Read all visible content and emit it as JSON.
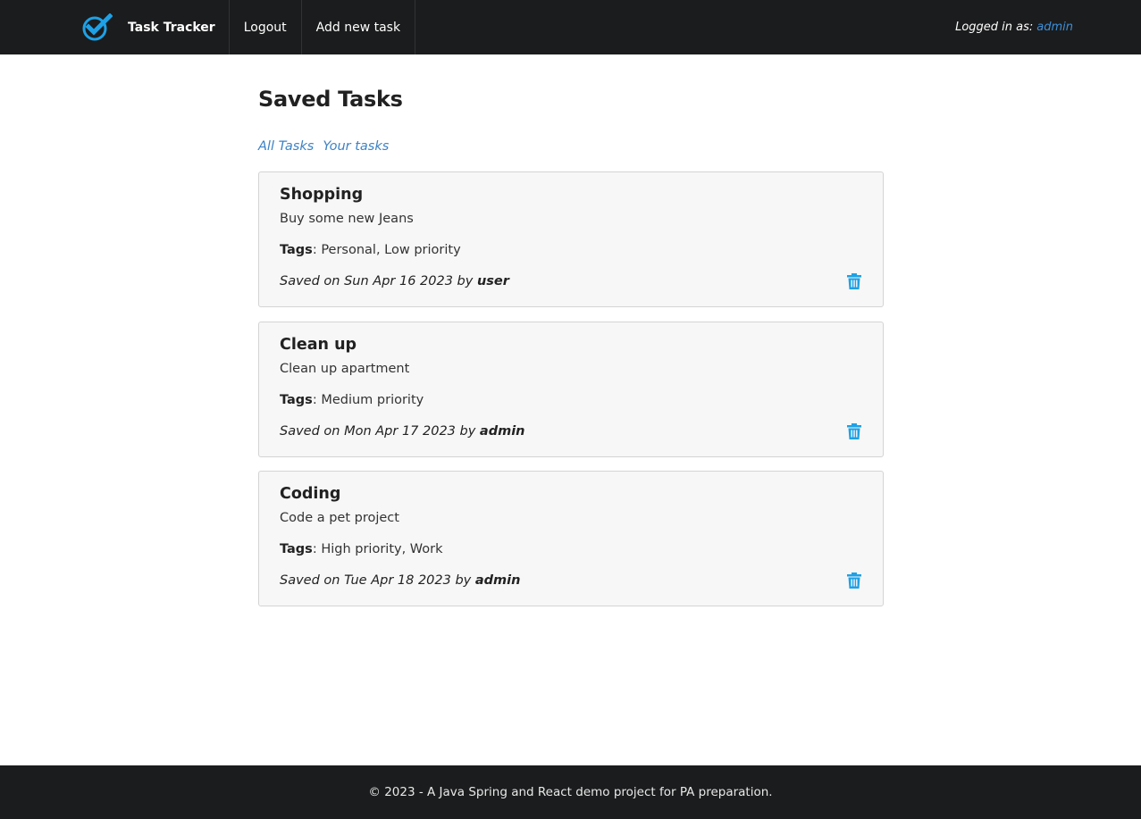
{
  "nav": {
    "brand": "Task Tracker",
    "logout": "Logout",
    "add_task": "Add new task",
    "logged_in_label": "Logged in as:",
    "logged_in_user": "admin"
  },
  "page": {
    "title": "Saved Tasks",
    "filters": {
      "all": "All Tasks",
      "yours": "Your tasks"
    }
  },
  "tasks": [
    {
      "title": "Shopping",
      "description": "Buy some new Jeans",
      "tags_label": "Tags",
      "tags": ": Personal, Low priority",
      "saved_prefix": "Saved on Sun Apr 16 2023 by",
      "author": "user"
    },
    {
      "title": "Clean up",
      "description": "Clean up apartment",
      "tags_label": "Tags",
      "tags": ": Medium priority",
      "saved_prefix": "Saved on Mon Apr 17 2023 by",
      "author": "admin"
    },
    {
      "title": "Coding",
      "description": "Code a pet project",
      "tags_label": "Tags",
      "tags": ": High priority, Work",
      "saved_prefix": "Saved on Tue Apr 18 2023 by",
      "author": "admin"
    }
  ],
  "footer": {
    "text": "© 2023 - A Java Spring and React demo project for PA preparation."
  },
  "colors": {
    "nav_bg": "#1b1c1d",
    "accent": "#1ea1e6",
    "link": "#3d82c4"
  },
  "icons": {
    "logo": "checkmark-circle-icon",
    "delete": "trash-icon"
  }
}
